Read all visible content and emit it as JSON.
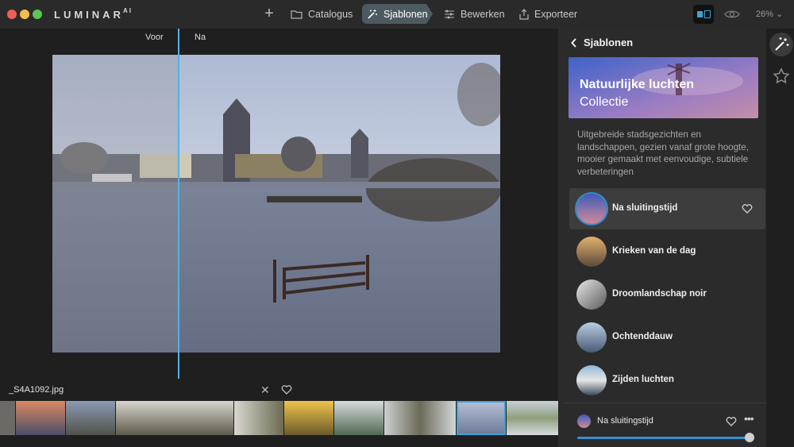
{
  "app": {
    "logo": "LUMINAR",
    "logo_suffix": "AI"
  },
  "nav": {
    "catalog": "Catalogus",
    "templates": "Sjablonen",
    "edit": "Bewerken",
    "export": "Exporteer",
    "zoom": "26%"
  },
  "canvas": {
    "before_label": "Voor",
    "after_label": "Na"
  },
  "filmstrip": {
    "file_name": "_S4A1092.jpg"
  },
  "panel": {
    "back_label": "Sjablonen",
    "banner_title": "Natuurlijke luchten",
    "banner_subtitle": "Collectie",
    "description": "Uitgebreide stadsgezichten en landschappen, gezien vanaf grote hoogte, mooier gemaakt met eenvoudige, subtiele verbeteringen",
    "templates": [
      {
        "label": "Na sluitingstijd",
        "active": true
      },
      {
        "label": "Krieken van de dag"
      },
      {
        "label": "Droomlandschap noir"
      },
      {
        "label": "Ochtenddauw"
      },
      {
        "label": "Zijden luchten"
      }
    ],
    "current": {
      "label": "Na sluitingstijd",
      "amount": 100
    }
  },
  "colors": {
    "accent": "#3aa3d6",
    "active_tab": "#4d5a62",
    "panel": "#2b2b2b"
  },
  "icons": [
    "plus-icon",
    "folder-icon",
    "magic-wand-icon",
    "sliders-icon",
    "export-icon",
    "compare-icon",
    "eye-icon",
    "chevron-left-icon",
    "heart-icon",
    "close-icon",
    "star-icon",
    "more-icon"
  ]
}
